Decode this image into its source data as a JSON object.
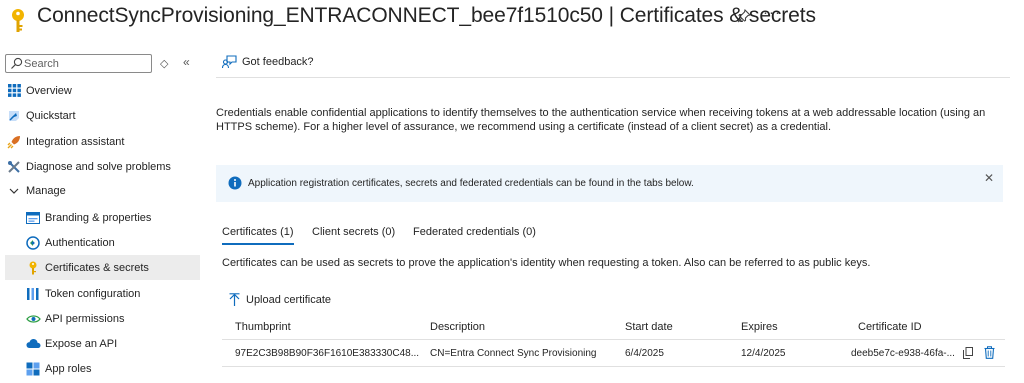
{
  "header": {
    "title": "ConnectSyncProvisioning_ENTRACONNECT_bee7f1510c50 | Certificates & secrets",
    "more": "···"
  },
  "sidebar": {
    "search_placeholder": "Search",
    "expand_glyph": "◇",
    "collapse_glyph": "«",
    "items": [
      {
        "label": "Overview",
        "icon": "overview-grid-icon"
      },
      {
        "label": "Quickstart",
        "icon": "quickstart-icon"
      },
      {
        "label": "Integration assistant",
        "icon": "rocket-icon"
      },
      {
        "label": "Diagnose and solve problems",
        "icon": "wrench-icon"
      },
      {
        "label": "Manage",
        "icon": "chevron-down-icon"
      },
      {
        "label": "Branding & properties",
        "icon": "branding-icon"
      },
      {
        "label": "Authentication",
        "icon": "authentication-icon"
      },
      {
        "label": "Certificates & secrets",
        "icon": "key-icon",
        "selected": true
      },
      {
        "label": "Token configuration",
        "icon": "token-bars-icon"
      },
      {
        "label": "API permissions",
        "icon": "api-permissions-icon"
      },
      {
        "label": "Expose an API",
        "icon": "cloud-icon"
      },
      {
        "label": "App roles",
        "icon": "app-roles-icon"
      }
    ]
  },
  "toolbar": {
    "feedback_label": "Got feedback?"
  },
  "intro": "Credentials enable confidential applications to identify themselves to the authentication service when receiving tokens at a web addressable location (using an HTTPS scheme). For a higher level of assurance, we recommend using a certificate (instead of a client secret) as a credential.",
  "info_bar": {
    "message": "Application registration certificates, secrets and federated credentials can be found in the tabs below.",
    "close": "✕"
  },
  "tabs": [
    {
      "label": "Certificates (1)",
      "active": true
    },
    {
      "label": "Client secrets (0)",
      "active": false
    },
    {
      "label": "Federated credentials (0)",
      "active": false
    }
  ],
  "tab_description": "Certificates can be used as secrets to prove the application's identity when requesting a token. Also can be referred to as public keys.",
  "upload_label": "Upload certificate",
  "table": {
    "columns": [
      "Thumbprint",
      "Description",
      "Start date",
      "Expires",
      "Certificate ID"
    ],
    "rows": [
      {
        "thumbprint": "97E2C3B98B90F36F1610E383330C48...",
        "description": "CN=Entra Connect Sync Provisioning",
        "start_date": "6/4/2025",
        "expires": "12/4/2025",
        "certificate_id": "deeb5e7c-e938-46fa-..."
      }
    ]
  },
  "colors": {
    "accent": "#0f6cbd",
    "key_gold": "#f2b400",
    "info_bg": "#eff6fc",
    "selected_bg": "#ececec"
  }
}
